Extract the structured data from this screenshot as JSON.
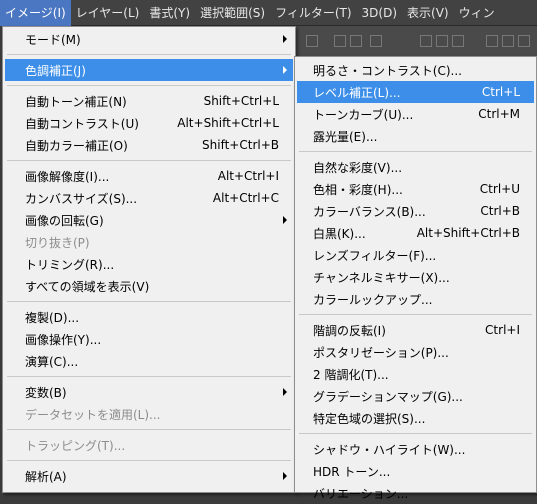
{
  "menubar": [
    "イメージ(I)",
    "レイヤー(L)",
    "書式(Y)",
    "選択範囲(S)",
    "フィルター(T)",
    "3D(D)",
    "表示(V)",
    "ウィン"
  ],
  "image_menu": [
    {
      "label": "モード(M)",
      "submenu": true
    },
    {
      "sep": true
    },
    {
      "label": "色調補正(J)",
      "submenu": true,
      "highlight": true
    },
    {
      "sep": true
    },
    {
      "label": "自動トーン補正(N)",
      "shortcut": "Shift+Ctrl+L"
    },
    {
      "label": "自動コントラスト(U)",
      "shortcut": "Alt+Shift+Ctrl+L"
    },
    {
      "label": "自動カラー補正(O)",
      "shortcut": "Shift+Ctrl+B"
    },
    {
      "sep": true
    },
    {
      "label": "画像解像度(I)...",
      "shortcut": "Alt+Ctrl+I"
    },
    {
      "label": "カンバスサイズ(S)...",
      "shortcut": "Alt+Ctrl+C"
    },
    {
      "label": "画像の回転(G)",
      "submenu": true
    },
    {
      "label": "切り抜き(P)",
      "disabled": true
    },
    {
      "label": "トリミング(R)..."
    },
    {
      "label": "すべての領域を表示(V)"
    },
    {
      "sep": true
    },
    {
      "label": "複製(D)..."
    },
    {
      "label": "画像操作(Y)..."
    },
    {
      "label": "演算(C)..."
    },
    {
      "sep": true
    },
    {
      "label": "変数(B)",
      "submenu": true
    },
    {
      "label": "データセットを適用(L)...",
      "disabled": true
    },
    {
      "sep": true
    },
    {
      "label": "トラッピング(T)...",
      "disabled": true
    },
    {
      "sep": true
    },
    {
      "label": "解析(A)",
      "submenu": true
    }
  ],
  "adjustments_menu": [
    {
      "label": "明るさ・コントラスト(C)..."
    },
    {
      "label": "レベル補正(L)...",
      "shortcut": "Ctrl+L",
      "highlight": true
    },
    {
      "label": "トーンカーブ(U)...",
      "shortcut": "Ctrl+M"
    },
    {
      "label": "露光量(E)..."
    },
    {
      "sep": true
    },
    {
      "label": "自然な彩度(V)..."
    },
    {
      "label": "色相・彩度(H)...",
      "shortcut": "Ctrl+U"
    },
    {
      "label": "カラーバランス(B)...",
      "shortcut": "Ctrl+B"
    },
    {
      "label": "白黒(K)...",
      "shortcut": "Alt+Shift+Ctrl+B"
    },
    {
      "label": "レンズフィルター(F)..."
    },
    {
      "label": "チャンネルミキサー(X)..."
    },
    {
      "label": "カラールックアップ..."
    },
    {
      "sep": true
    },
    {
      "label": "階調の反転(I)",
      "shortcut": "Ctrl+I"
    },
    {
      "label": "ポスタリゼーション(P)..."
    },
    {
      "label": "2 階調化(T)..."
    },
    {
      "label": "グラデーションマップ(G)..."
    },
    {
      "label": "特定色域の選択(S)..."
    },
    {
      "sep": true
    },
    {
      "label": "シャドウ・ハイライト(W)..."
    },
    {
      "label": "HDR トーン..."
    },
    {
      "label": "バリエーション..."
    }
  ]
}
